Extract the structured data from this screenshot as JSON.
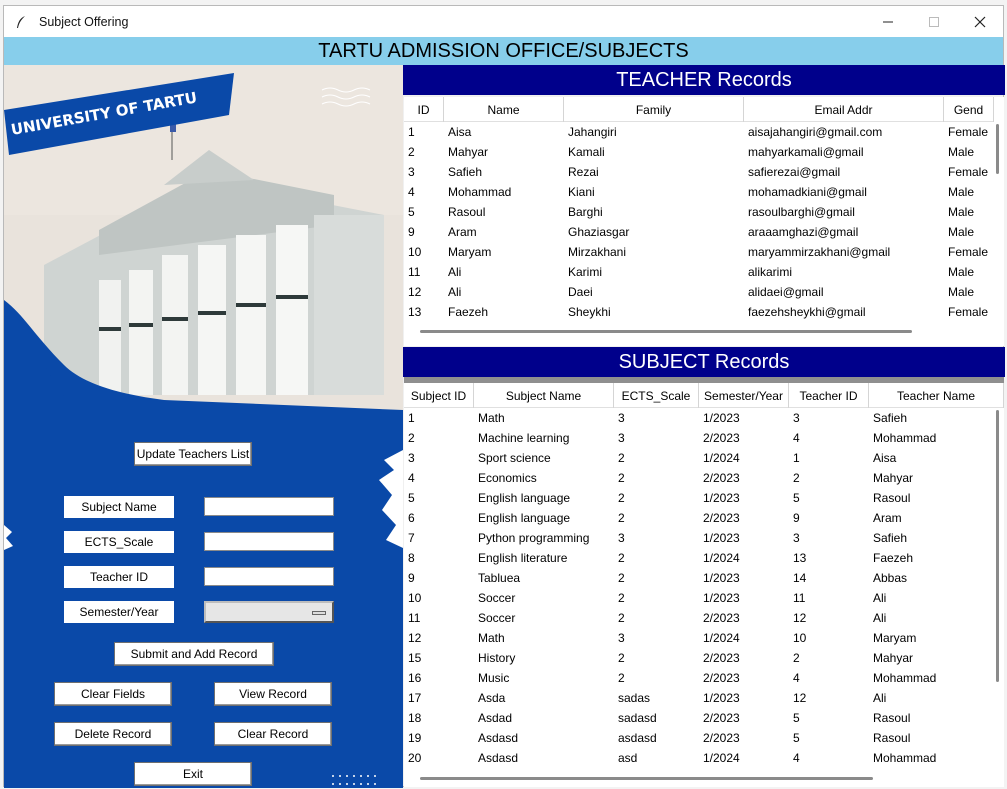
{
  "window": {
    "title": "Subject Offering"
  },
  "header": {
    "title": "TARTU ADMISSION OFFICE/SUBJECTS"
  },
  "banner": {
    "text": "UNIVERSITY OF TARTU"
  },
  "form": {
    "update_btn": "Update Teachers List",
    "subject_name_label": "Subject Name",
    "ects_label": "ECTS_Scale",
    "teacher_id_label": "Teacher ID",
    "semester_label": "Semester/Year",
    "subject_name_value": "",
    "ects_value": "",
    "teacher_id_value": "",
    "semester_value": "",
    "submit_btn": "Submit and Add Record",
    "clear_fields_btn": "Clear Fields",
    "view_record_btn": "View Record",
    "delete_record_btn": "Delete Record",
    "clear_record_btn": "Clear Record",
    "exit_btn": "Exit"
  },
  "teacher": {
    "title": "TEACHER Records",
    "columns": [
      "ID",
      "Name",
      "Family",
      "Email Addr",
      "Gend"
    ],
    "rows": [
      [
        "1",
        "Aisa",
        "Jahangiri",
        "aisajahangiri@gmail.com",
        "Female"
      ],
      [
        "2",
        "Mahyar",
        "Kamali",
        "mahyarkamali@gmail",
        "Male"
      ],
      [
        "3",
        "Safieh",
        "Rezai",
        "safierezai@gmail",
        "Female"
      ],
      [
        "4",
        "Mohammad",
        "Kiani",
        "mohamadkiani@gmail",
        "Male"
      ],
      [
        "5",
        "Rasoul",
        "Barghi",
        "rasoulbarghi@gmail",
        "Male"
      ],
      [
        "9",
        "Aram",
        "Ghaziasgar",
        "araaamghazi@gmail",
        "Male"
      ],
      [
        "10",
        "Maryam",
        "Mirzakhani",
        "maryammirzakhani@gmail",
        "Female"
      ],
      [
        "11",
        "Ali",
        "Karimi",
        "alikarimi",
        "Male"
      ],
      [
        "12",
        "Ali",
        "Daei",
        "alidaei@gmail",
        "Male"
      ],
      [
        "13",
        "Faezeh",
        "Sheykhi",
        "faezehsheykhi@gmail",
        "Female"
      ]
    ]
  },
  "subject": {
    "title": "SUBJECT Records",
    "columns": [
      "Subject ID",
      "Subject Name",
      "ECTS_Scale",
      "Semester/Year",
      "Teacher ID",
      "Teacher Name"
    ],
    "rows": [
      [
        "1",
        "Math",
        "3",
        "1/2023",
        "3",
        "Safieh"
      ],
      [
        "2",
        "Machine learning",
        "3",
        "2/2023",
        "4",
        "Mohammad"
      ],
      [
        "3",
        "Sport science",
        "2",
        "1/2024",
        "1",
        "Aisa"
      ],
      [
        "4",
        "Economics",
        "2",
        "2/2023",
        "2",
        "Mahyar"
      ],
      [
        "5",
        "English language",
        "2",
        "1/2023",
        "5",
        "Rasoul"
      ],
      [
        "6",
        "English language",
        "2",
        "2/2023",
        "9",
        "Aram"
      ],
      [
        "7",
        "Python programming",
        "3",
        "1/2023",
        "3",
        "Safieh"
      ],
      [
        "8",
        "English literature",
        "2",
        "1/2024",
        "13",
        "Faezeh"
      ],
      [
        "9",
        "Tabluea",
        "2",
        "1/2023",
        "14",
        "Abbas"
      ],
      [
        "10",
        "Soccer",
        "2",
        "1/2023",
        "11",
        "Ali"
      ],
      [
        "11",
        "Soccer",
        "2",
        "2/2023",
        "12",
        "Ali"
      ],
      [
        "12",
        "Math",
        "3",
        "1/2024",
        "10",
        "Maryam"
      ],
      [
        "15",
        "History",
        "2",
        "2/2023",
        "2",
        "Mahyar"
      ],
      [
        "16",
        "Music",
        "2",
        "2/2023",
        "4",
        "Mohammad"
      ],
      [
        "17",
        "Asda",
        "sadas",
        "1/2023",
        "12",
        "Ali"
      ],
      [
        "18",
        "Asdad",
        "sadasd",
        "2/2023",
        "5",
        "Rasoul"
      ],
      [
        "19",
        "Asdasd",
        "asdasd",
        "2/2023",
        "5",
        "Rasoul"
      ],
      [
        "20",
        "Asdasd",
        "asd",
        "1/2024",
        "4",
        "Mohammad"
      ]
    ]
  },
  "colors": {
    "header": "#87ceeb",
    "section": "#00008b",
    "panel": "#0a49a8"
  },
  "icons": {
    "app": "feather-icon",
    "minimize": "minimize-icon",
    "maximize": "maximize-icon",
    "close": "close-icon"
  }
}
